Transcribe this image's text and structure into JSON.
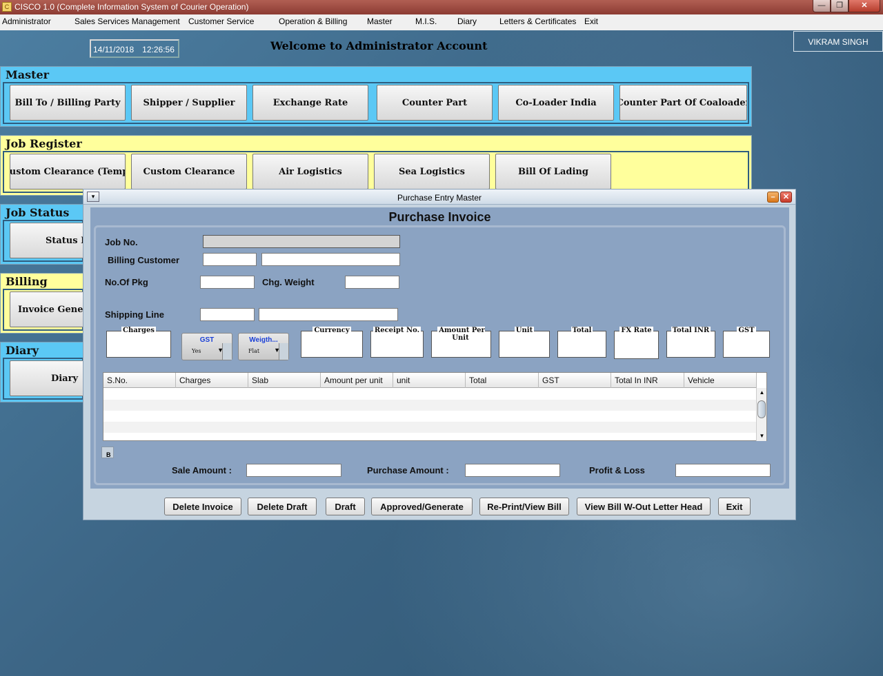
{
  "window": {
    "title": "CISCO 1.0 (Complete Information System of Courier Operation)",
    "icon_glyph": "C"
  },
  "window_controls": {
    "minimize": "—",
    "maximize": "❐",
    "close": "✕"
  },
  "menubar": {
    "items": [
      "Administrator",
      "Sales Services Management",
      "Customer Service",
      "Operation & Billing",
      "Master",
      "M.I.S.",
      "Diary",
      "Letters & Certificates",
      "Exit"
    ]
  },
  "header": {
    "date": "14/11/2018",
    "time": "12:26:56",
    "welcome": "Welcome to Administrator Account",
    "user": "VIKRAM SINGH"
  },
  "panels": {
    "master": {
      "title": "Master",
      "buttons": [
        "Bill To / Billing Party",
        "Shipper / Supplier",
        "Exchange Rate",
        "Counter Part",
        "Co-Loader India",
        "Counter Part Of Coaloader"
      ]
    },
    "job_register": {
      "title": "Job Register",
      "buttons": [
        "Custom Clearance (Temp)",
        "Custom Clearance",
        "Air Logistics",
        "Sea Logistics",
        "Bill Of Lading"
      ]
    },
    "job_status": {
      "title": "Job Status",
      "button": "Status E"
    },
    "billing": {
      "title": "Billing",
      "button": "Invoice Genera"
    },
    "diary": {
      "title": "Diary",
      "button": "Diary"
    }
  },
  "dialog": {
    "title": "Purchase Entry Master",
    "menu_glyph": "▾",
    "min_glyph": "–",
    "close_glyph": "✕",
    "heading": "Purchase Invoice",
    "labels": {
      "job_no": "Job No.",
      "billing_customer": "Billing Customer",
      "no_of_pkg": "No.Of Pkg",
      "chg_weight": "Chg. Weight",
      "shipping_line": "Shipping Line",
      "sale_amount": "Sale Amount :",
      "purchase_amount": "Purchase Amount :",
      "profit_loss": "Profit & Loss"
    },
    "charge_fields": {
      "charges": "Charges",
      "currency": "Currency",
      "receipt_no": "Receipt No.",
      "amount_per_unit": "Amount Per Unit",
      "unit": "Unit",
      "total": "Total",
      "fx_rate": "FX Rate",
      "total_inr": "Total INR",
      "gst": "GST"
    },
    "combos": {
      "gst": {
        "label": "GST",
        "value": "Yes"
      },
      "weight": {
        "label": "Weigth...",
        "value": "Flat"
      }
    },
    "combo_arrow": "▼",
    "table": {
      "columns": [
        "S.No.",
        "Charges",
        "Slab",
        "Amount per unit",
        "unit",
        "Total",
        "GST",
        "Total In INR",
        "Vehicle"
      ]
    },
    "scroll": {
      "up": "▲",
      "down": "▼"
    },
    "tiny_box": "B",
    "buttons": [
      "Delete Invoice",
      "Delete Draft",
      "Draft",
      "Approved/Generate",
      "Re-Print/View Bill",
      "View Bill W-Out Letter Head",
      "Exit"
    ]
  }
}
